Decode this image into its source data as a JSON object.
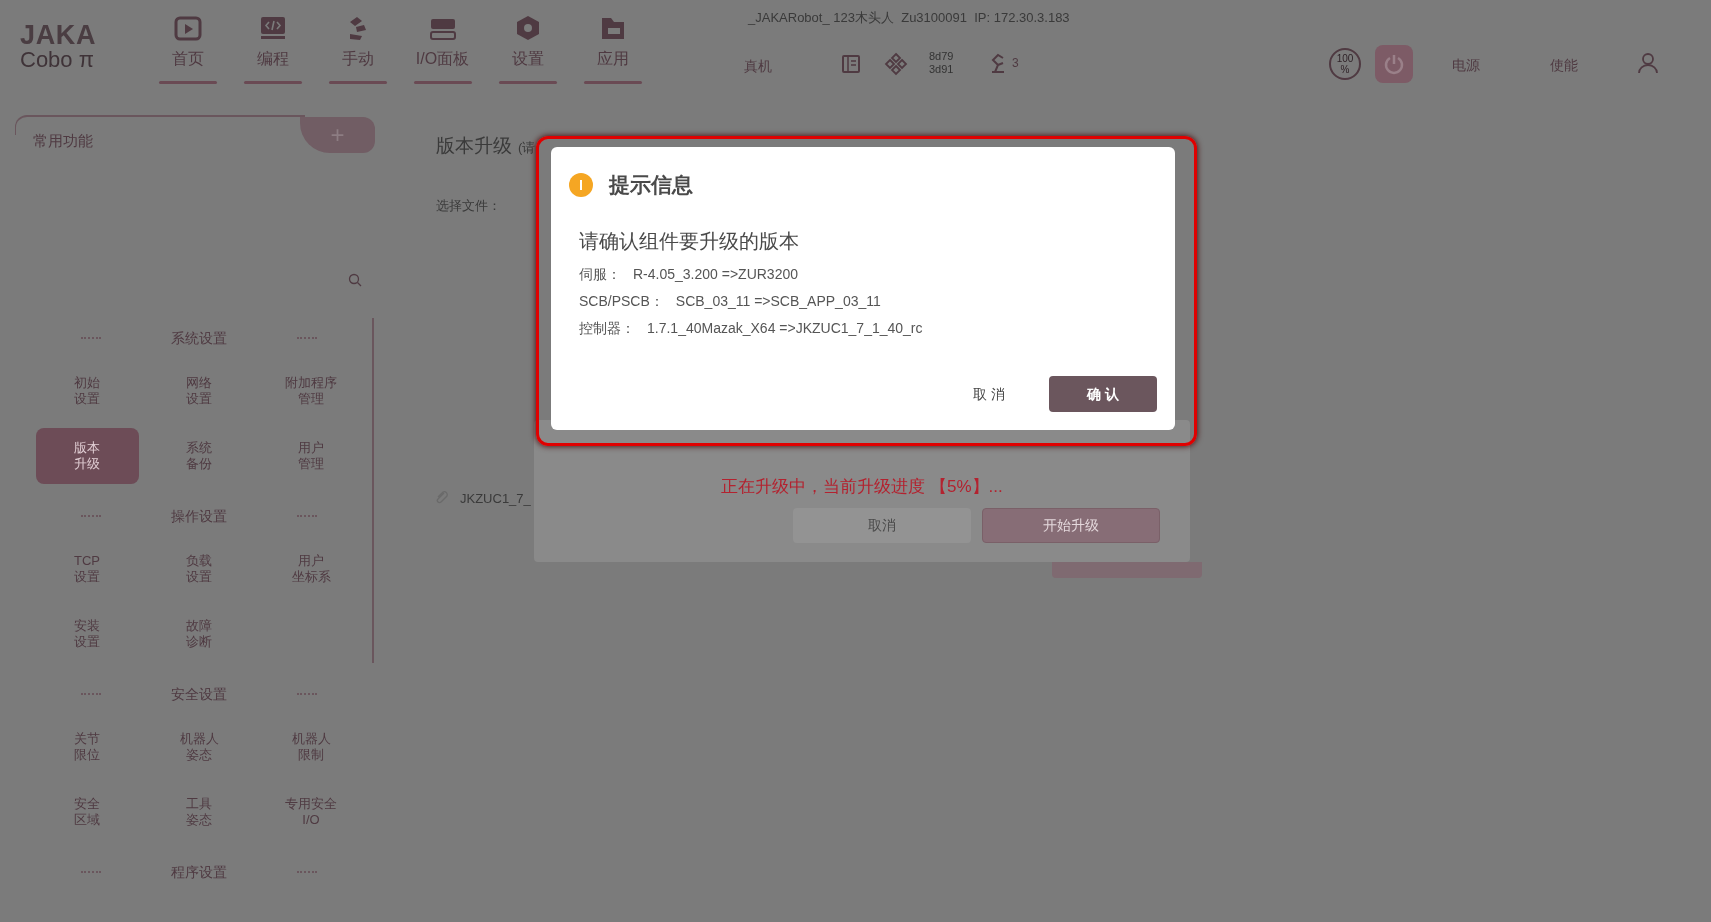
{
  "header": {
    "logo": {
      "brand": "JAKA",
      "product": "Cobo π"
    },
    "device_info": "_JAKARobot_ 123木头人  Zu3100091  IP: 172.30.3.183",
    "nav": [
      {
        "label": "首页"
      },
      {
        "label": "编程"
      },
      {
        "label": "手动"
      },
      {
        "label": "I/O面板"
      },
      {
        "label": "设置"
      },
      {
        "label": "应用"
      }
    ],
    "mode": "真机",
    "code": [
      "8d79",
      "3d91"
    ],
    "robot_count": "3",
    "speed": [
      "100",
      "%"
    ],
    "power": "电源",
    "enable": "使能"
  },
  "sidebar": {
    "title": "常用功能",
    "add": "+",
    "sections": [
      {
        "title": "系统设置",
        "items": [
          {
            "lines": [
              "初始",
              "设置"
            ],
            "selected": false
          },
          {
            "lines": [
              "网络",
              "设置"
            ],
            "selected": false
          },
          {
            "lines": [
              "附加程序",
              "管理"
            ],
            "selected": false
          },
          {
            "lines": [
              "版本",
              "升级"
            ],
            "selected": true
          },
          {
            "lines": [
              "系统",
              "备份"
            ],
            "selected": false
          },
          {
            "lines": [
              "用户",
              "管理"
            ],
            "selected": false
          }
        ]
      },
      {
        "title": "操作设置",
        "items": [
          {
            "lines": [
              "TCP",
              "设置"
            ],
            "selected": false
          },
          {
            "lines": [
              "负载",
              "设置"
            ],
            "selected": false
          },
          {
            "lines": [
              "用户",
              "坐标系"
            ],
            "selected": false
          },
          {
            "lines": [
              "安装",
              "设置"
            ],
            "selected": false
          },
          {
            "lines": [
              "故障",
              "诊断"
            ],
            "selected": false
          }
        ]
      },
      {
        "title": "安全设置",
        "items": [
          {
            "lines": [
              "关节",
              "限位"
            ],
            "selected": false
          },
          {
            "lines": [
              "机器人",
              "姿态"
            ],
            "selected": false
          },
          {
            "lines": [
              "机器人",
              "限制"
            ],
            "selected": false
          },
          {
            "lines": [
              "安全",
              "区域"
            ],
            "selected": false
          },
          {
            "lines": [
              "工具",
              "姿态"
            ],
            "selected": false
          },
          {
            "lines": [
              "专用安全",
              "I/O"
            ],
            "selected": false
          }
        ]
      },
      {
        "title": "程序设置"
      }
    ]
  },
  "main": {
    "title": "版本升级",
    "subtitle": "(请",
    "file_label": "选择文件：",
    "file_name": "JKZUC1_7_"
  },
  "progress": {
    "message": "正在升级中，当前升级进度 【5%】...",
    "buttons": [
      {
        "label": "取消",
        "kind": "secondary"
      },
      {
        "label": "开始升级",
        "kind": "primary"
      }
    ]
  },
  "dialog": {
    "title": "提示信息",
    "heading": "请确认组件要升级的版本",
    "lines": [
      {
        "label": "伺服：",
        "value": "R-4.05_3.200 =>ZUR3200"
      },
      {
        "label": "SCB/PSCB：",
        "value": "SCB_03_11 =>SCB_APP_03_11"
      },
      {
        "label": "控制器：",
        "value": "1.7.1_40Mazak_X64 =>JKZUC1_7_1_40_rc"
      }
    ],
    "cancel": "取 消",
    "confirm": "确 认"
  }
}
